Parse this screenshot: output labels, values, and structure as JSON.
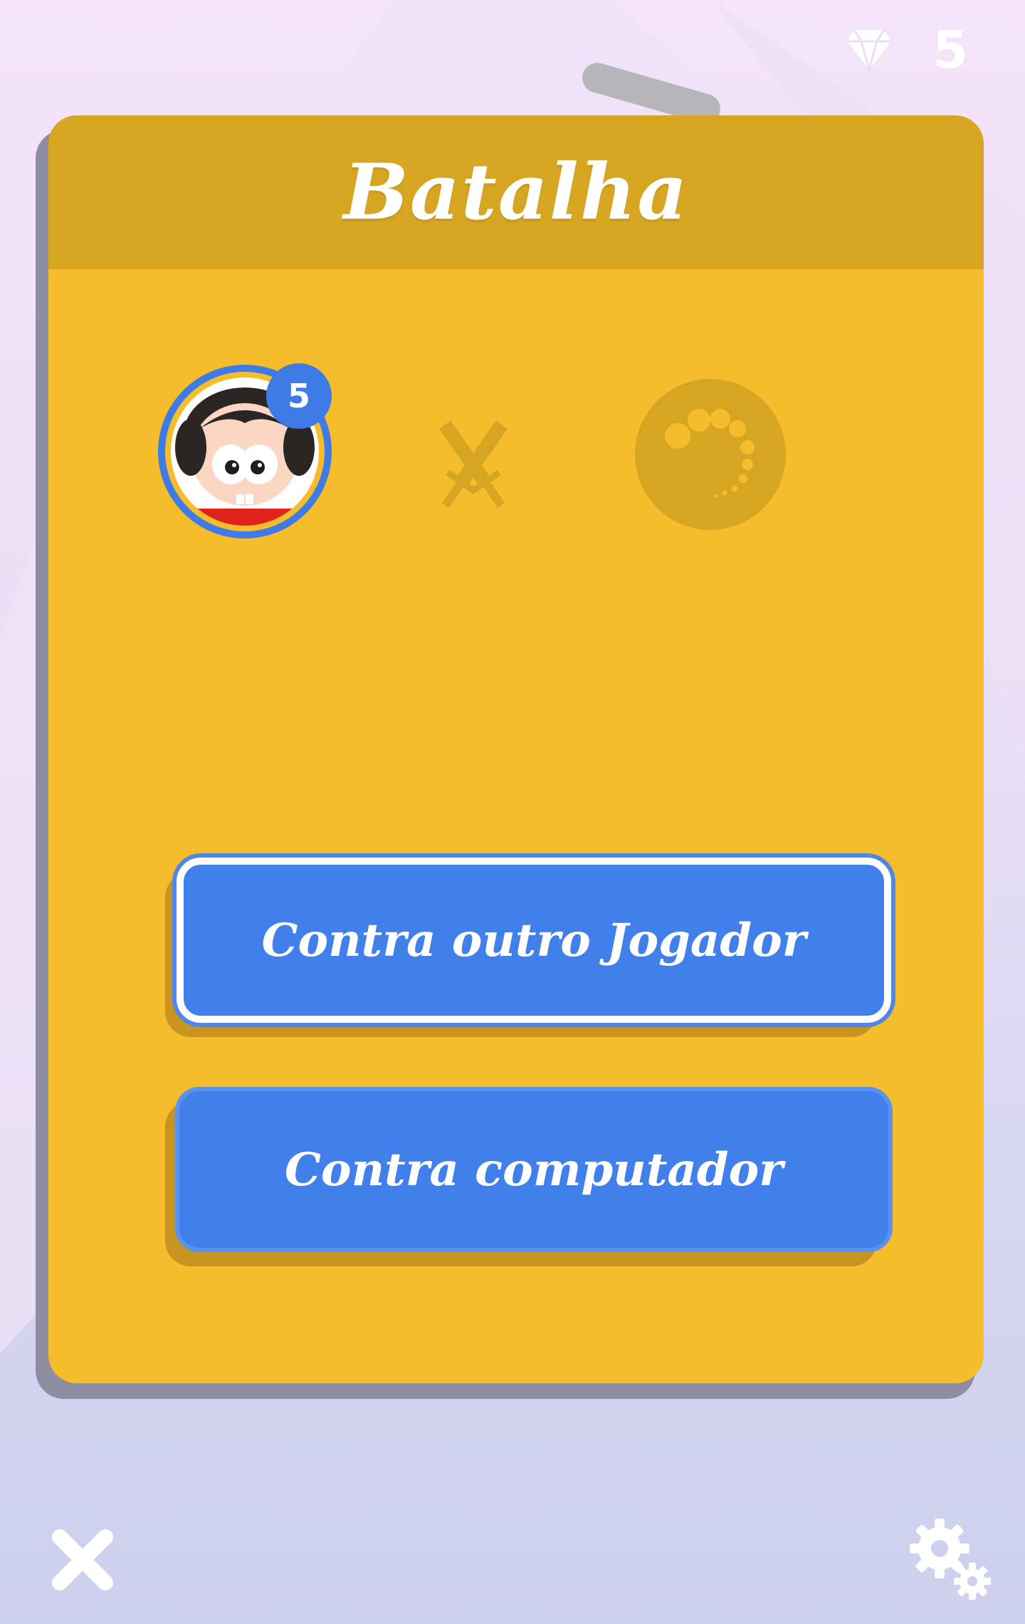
{
  "hud": {
    "gem_icon": "diamond-icon",
    "gem_count": "5"
  },
  "dialog": {
    "title": "Batalha",
    "player": {
      "avatar": "character-avatar",
      "level": "5"
    },
    "versus_icon": "crossed-swords-icon",
    "opponent_status": "loading-spinner-icon",
    "buttons": {
      "vs_player": "Contra outro Jogador",
      "vs_computer": "Contra computador"
    }
  },
  "footer": {
    "close_icon": "close-icon",
    "settings_icon": "gears-icon"
  },
  "colors": {
    "card": "#f5bd2b",
    "header": "#d6a623",
    "button": "#417fea",
    "badge": "#3f7be6"
  }
}
